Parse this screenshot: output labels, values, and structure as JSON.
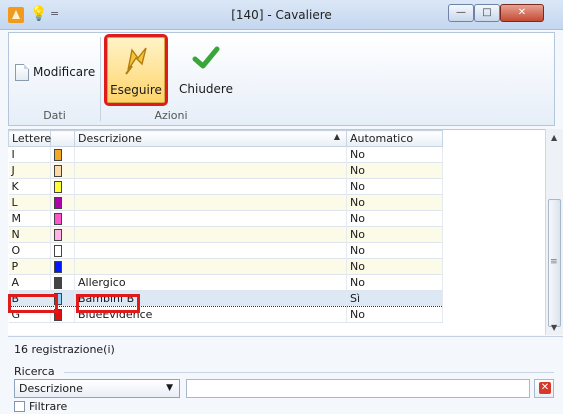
{
  "window": {
    "title": "[140] - Cavaliere",
    "separator": "="
  },
  "ribbon": {
    "groups": [
      {
        "label": "Dati",
        "buttons": [
          {
            "label": "Modificare"
          }
        ]
      },
      {
        "label": "Azioni",
        "buttons": [
          {
            "label": "Eseguire"
          },
          {
            "label": "Chiudere"
          }
        ]
      }
    ]
  },
  "grid": {
    "columns": [
      "Lettere",
      "",
      "Descrizione",
      "Automatico"
    ],
    "rows": [
      {
        "letter": "I",
        "color": "#f5a623",
        "desc": "",
        "auto": "No"
      },
      {
        "letter": "J",
        "color": "#fcd9a8",
        "desc": "",
        "auto": "No"
      },
      {
        "letter": "K",
        "color": "#ffff33",
        "desc": "",
        "auto": "No"
      },
      {
        "letter": "L",
        "color": "#b000b0",
        "desc": "",
        "auto": "No"
      },
      {
        "letter": "M",
        "color": "#ff55cc",
        "desc": "",
        "auto": "No"
      },
      {
        "letter": "N",
        "color": "#ffb3e6",
        "desc": "",
        "auto": "No"
      },
      {
        "letter": "O",
        "color": "#ffffff",
        "desc": "",
        "auto": "No"
      },
      {
        "letter": "P",
        "color": "#0018ff",
        "desc": "",
        "auto": "No"
      },
      {
        "letter": "A",
        "color": "#444444",
        "desc": "Allergico",
        "auto": "No"
      },
      {
        "letter": "B",
        "color": "#8fd3f4",
        "desc": "Bambini B",
        "auto": "Sì"
      },
      {
        "letter": "G",
        "color": "#e01010",
        "desc": "BlueEvidence",
        "auto": "No"
      }
    ],
    "selected_row": "B"
  },
  "footer": {
    "count": "16 registrazione(i)",
    "search_label": "Ricerca",
    "field_select": "Descrizione",
    "search_value": "",
    "filter_label": "Filtrare"
  }
}
